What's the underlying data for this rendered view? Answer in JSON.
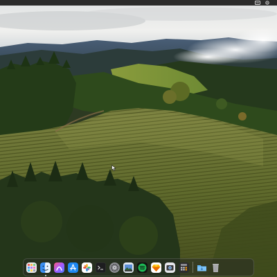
{
  "menubar": {
    "status_icons": [
      "menu-extra-icon",
      "control-center-icon"
    ]
  },
  "dock": {
    "apps": [
      {
        "id": "launchpad",
        "icon": "launchpad-icon",
        "running": false
      },
      {
        "id": "finder",
        "icon": "finder-icon",
        "running": true
      },
      {
        "id": "arc",
        "icon": "arc-browser-icon",
        "running": false
      },
      {
        "id": "app-store",
        "icon": "app-store-icon",
        "running": false
      },
      {
        "id": "photos",
        "icon": "photos-icon",
        "running": false
      },
      {
        "id": "terminal",
        "icon": "terminal-icon",
        "running": false
      },
      {
        "id": "system-settings",
        "icon": "settings-gear-icon",
        "running": false
      },
      {
        "id": "preview",
        "icon": "preview-icon",
        "running": false
      },
      {
        "id": "spotify",
        "icon": "spotify-icon",
        "running": false
      },
      {
        "id": "sketch",
        "icon": "sketch-icon",
        "running": false
      },
      {
        "id": "screenshot",
        "icon": "screenshot-icon",
        "running": false
      },
      {
        "id": "calculator",
        "icon": "calculator-icon",
        "running": false
      },
      {
        "id": "downloads",
        "icon": "folder-icon",
        "running": false
      },
      {
        "id": "trash",
        "icon": "trash-icon",
        "running": false
      }
    ]
  },
  "colors": {
    "menubar": "#2b2b2b",
    "sky": "#e9ecee",
    "hills": "#2d4a1e",
    "vineyard": "#6f7a38"
  }
}
